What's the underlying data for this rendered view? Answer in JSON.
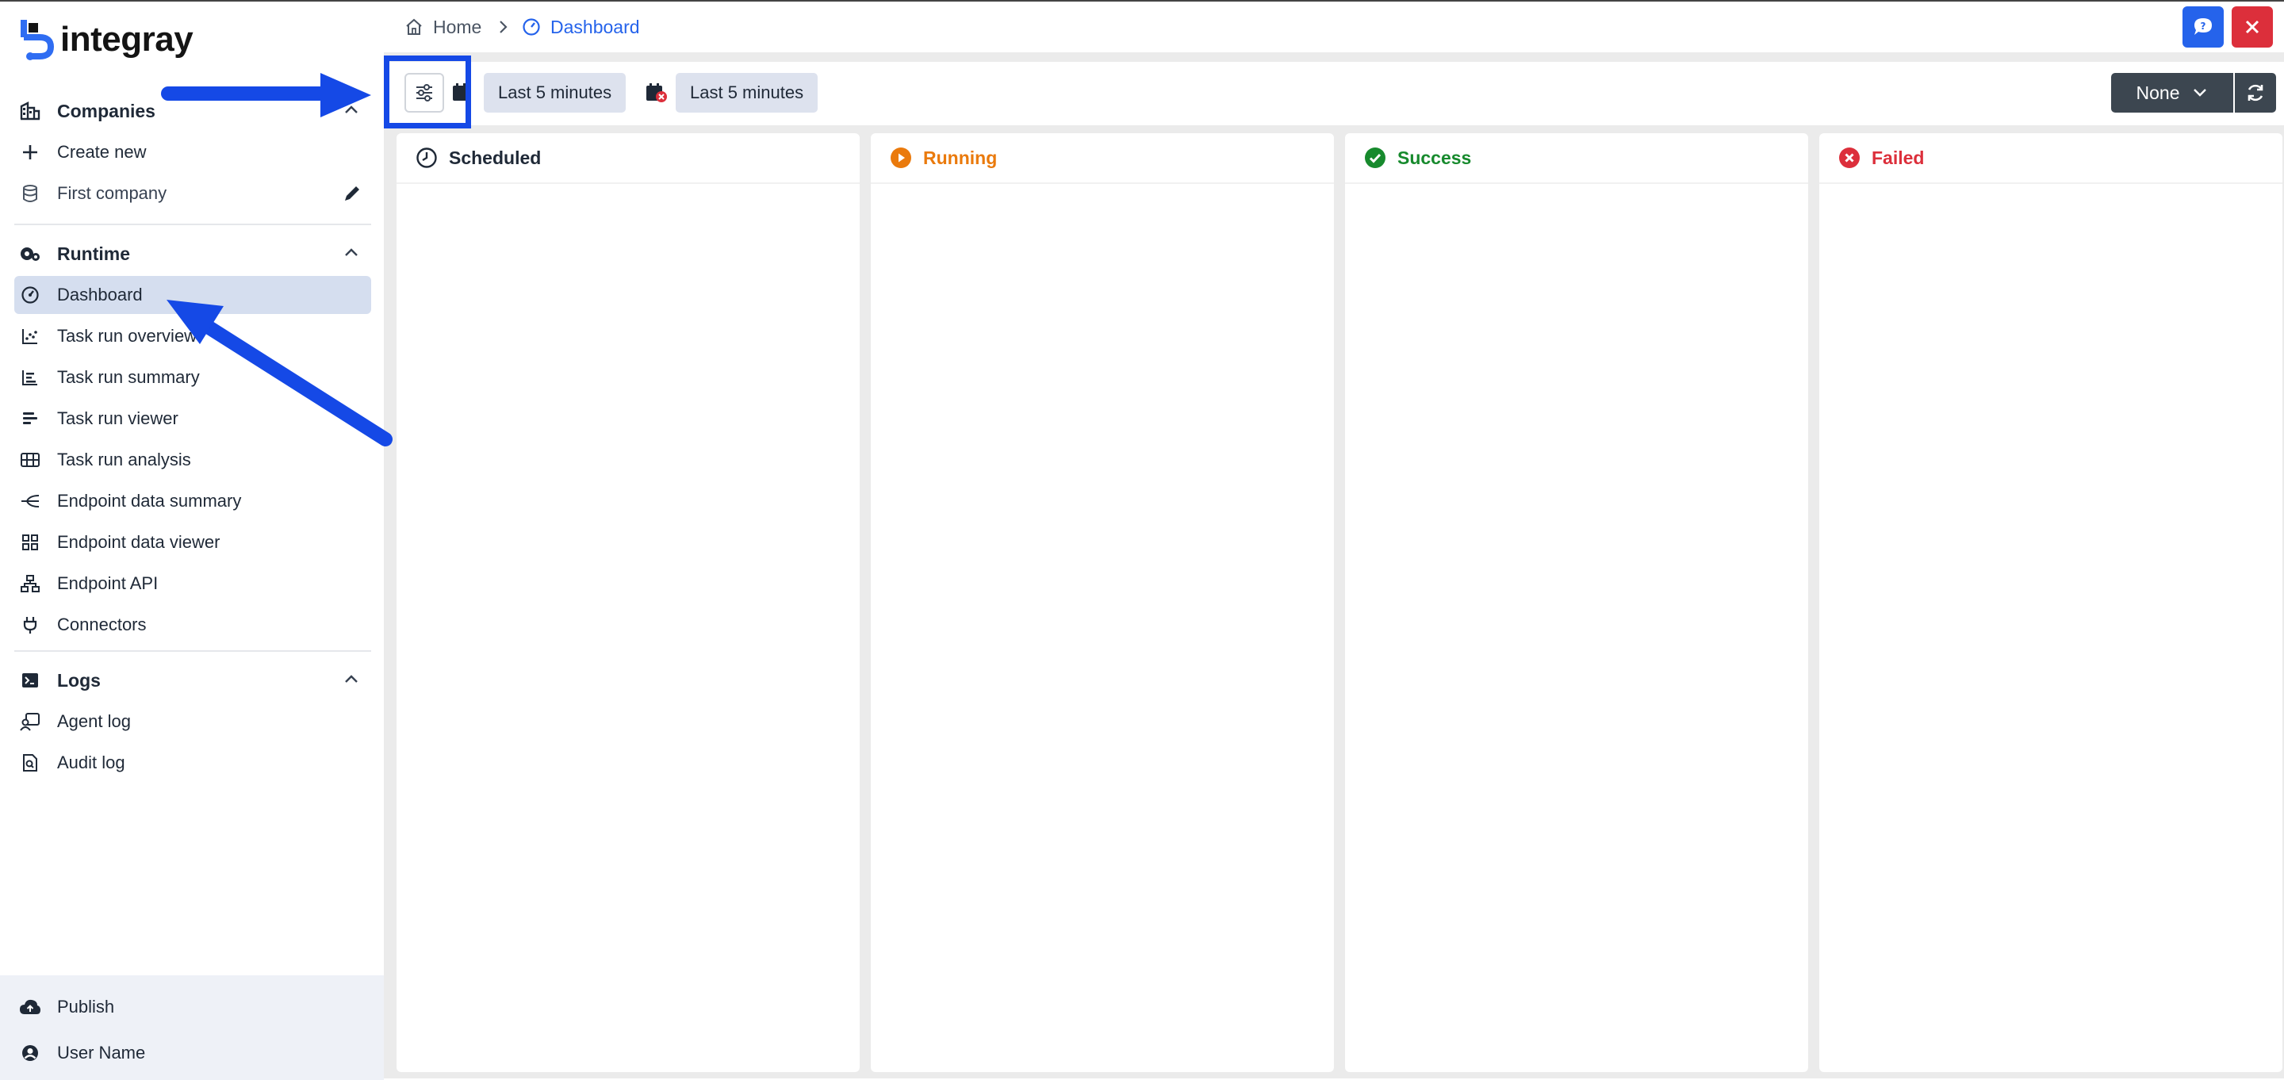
{
  "app": {
    "name": "integray"
  },
  "sidebar": {
    "companies": {
      "label": "Companies",
      "create_new": "Create new",
      "first_company": "First company"
    },
    "runtime": {
      "label": "Runtime",
      "items": [
        {
          "label": "Dashboard"
        },
        {
          "label": "Task run overview"
        },
        {
          "label": "Task run summary"
        },
        {
          "label": "Task run viewer"
        },
        {
          "label": "Task run analysis"
        },
        {
          "label": "Endpoint data summary"
        },
        {
          "label": "Endpoint data viewer"
        },
        {
          "label": "Endpoint API"
        },
        {
          "label": "Connectors"
        }
      ]
    },
    "logs": {
      "label": "Logs",
      "items": [
        {
          "label": "Agent log"
        },
        {
          "label": "Audit log"
        }
      ]
    },
    "bottom": {
      "publish": "Publish",
      "user": "User Name"
    }
  },
  "breadcrumb": {
    "home": "Home",
    "current": "Dashboard"
  },
  "toolbar": {
    "range_start": "Last 5 minutes",
    "range_end": "Last 5 minutes",
    "group_select": "None"
  },
  "columns": [
    {
      "title": "Scheduled",
      "color": "#1f2937"
    },
    {
      "title": "Running",
      "color": "#ea7a0c"
    },
    {
      "title": "Success",
      "color": "#178a2d"
    },
    {
      "title": "Failed",
      "color": "#dc2f3b"
    }
  ],
  "colors": {
    "accent": "#2563eb",
    "annotation": "#1549e6",
    "active_bg": "#d5deef"
  }
}
